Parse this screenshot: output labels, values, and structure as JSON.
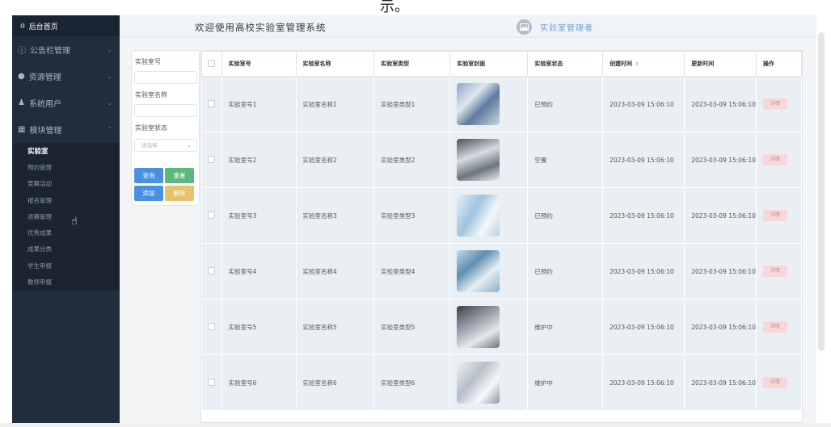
{
  "caption": "示。",
  "sidebar": {
    "home_label": "后台首页",
    "groups": [
      {
        "label": "公告栏管理"
      },
      {
        "label": "资源管理"
      },
      {
        "label": "系统用户"
      },
      {
        "label": "模块管理"
      }
    ],
    "sub_items": [
      {
        "label": "实验室",
        "active": true
      },
      {
        "label": "预约管理"
      },
      {
        "label": "竞赛活动"
      },
      {
        "label": "报名管理"
      },
      {
        "label": "退赛管理"
      },
      {
        "label": "优秀成果"
      },
      {
        "label": "成果分类"
      },
      {
        "label": "学生申报"
      },
      {
        "label": "教师申报"
      }
    ]
  },
  "header": {
    "title": "欢迎使用高校实验室管理系统",
    "user": "实验室管理者"
  },
  "search": {
    "field1_label": "实验室号",
    "field2_label": "实验室名称",
    "field3_label": "实验室状态",
    "select_placeholder": "请选择",
    "query_btn": "查询",
    "reset_btn": "重置",
    "add_btn": "添加",
    "delete_btn": "删除"
  },
  "colors": {
    "query": "#4a90e2",
    "reset": "#5cb87a",
    "add": "#4a90e2",
    "delete": "#e6c36b"
  },
  "table": {
    "headers": [
      "实验室号",
      "实验室名称",
      "实验室类型",
      "实验室封面",
      "实验室状态",
      "创建时间",
      "更新时间",
      "操作"
    ],
    "rows": [
      {
        "no": "实验室号1",
        "name": "实验室名称1",
        "type": "实验室类型1",
        "status": "已预约",
        "created": "2023-03-09 15:06:10",
        "updated": "2023-03-09 15:06:10",
        "action": "详情"
      },
      {
        "no": "实验室号2",
        "name": "实验室名称2",
        "type": "实验室类型2",
        "status": "空置",
        "created": "2023-03-09 15:06:10",
        "updated": "2023-03-09 15:06:10",
        "action": "详情"
      },
      {
        "no": "实验室号3",
        "name": "实验室名称3",
        "type": "实验室类型3",
        "status": "已预约",
        "created": "2023-03-09 15:06:10",
        "updated": "2023-03-09 15:06:10",
        "action": "详情"
      },
      {
        "no": "实验室号4",
        "name": "实验室名称4",
        "type": "实验室类型4",
        "status": "已预约",
        "created": "2023-03-09 15:06:10",
        "updated": "2023-03-09 15:06:10",
        "action": "详情"
      },
      {
        "no": "实验室号5",
        "name": "实验室名称5",
        "type": "实验室类型5",
        "status": "维护中",
        "created": "2023-03-09 15:06:10",
        "updated": "2023-03-09 15:06:10",
        "action": "详情"
      },
      {
        "no": "实验室号6",
        "name": "实验室名称6",
        "type": "实验室类型6",
        "status": "维护中",
        "created": "2023-03-09 15:06:10",
        "updated": "2023-03-09 15:06:10",
        "action": "详情"
      }
    ]
  }
}
